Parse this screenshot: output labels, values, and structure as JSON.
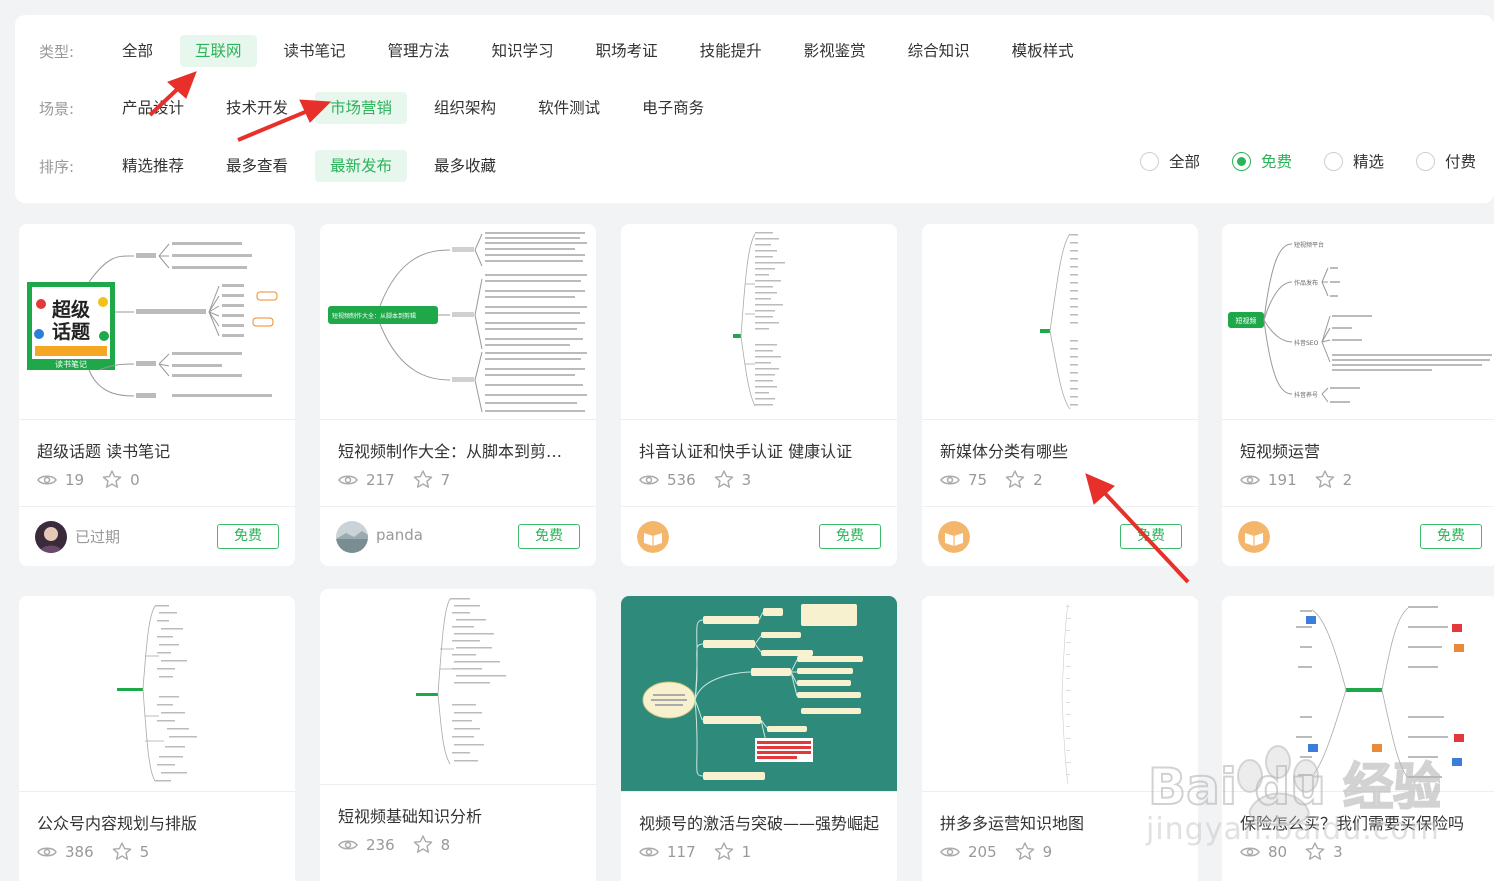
{
  "filters": {
    "type_label": "类型:",
    "types": [
      "全部",
      "互联网",
      "读书笔记",
      "管理方法",
      "知识学习",
      "职场考证",
      "技能提升",
      "影视鉴赏",
      "综合知识",
      "模板样式"
    ],
    "scene_label": "场景:",
    "scenes": [
      "产品设计",
      "技术开发",
      "市场营销",
      "组织架构",
      "软件测试",
      "电子商务"
    ],
    "sort_label": "排序:",
    "sorts": [
      "精选推荐",
      "最多查看",
      "最新发布",
      "最多收藏"
    ],
    "price_options": [
      "全部",
      "免费",
      "精选",
      "付费"
    ]
  },
  "colors": {
    "accent": "#2db35a",
    "accent_bg": "#e8f7ee",
    "arrow": "#e8302a",
    "teal_thumb": "#2e8a7a"
  },
  "cards": [
    {
      "title": "超级话题 读书笔记",
      "views": "19",
      "stars": "0",
      "user": "已过期",
      "badge": "免费"
    },
    {
      "title": "短视频制作大全：从脚本到剪辑的完整流程",
      "views": "217",
      "stars": "7",
      "user": "panda",
      "badge": "免费"
    },
    {
      "title": "抖音认证和快手认证 健康认证",
      "views": "536",
      "stars": "3",
      "user": "",
      "badge": "免费"
    },
    {
      "title": "新媒体分类有哪些",
      "views": "75",
      "stars": "2",
      "user": "",
      "badge": "免费"
    },
    {
      "title": "短视频运营",
      "views": "191",
      "stars": "2",
      "user": "",
      "badge": "免费"
    },
    {
      "title": "公众号内容规划与排版",
      "views": "386",
      "stars": "5"
    },
    {
      "title": "短视频基础知识分析",
      "views": "236",
      "stars": "8"
    },
    {
      "title": "视频号的激活与突破——强势崛起",
      "views": "117",
      "stars": "1"
    },
    {
      "title": "拼多多运营知识地图",
      "views": "205",
      "stars": "9"
    },
    {
      "title": "保险怎么买？我们需要买保险吗",
      "views": "80",
      "stars": "3"
    }
  ],
  "thumb_texts": {
    "book_line1": "超级",
    "book_line2": "话题",
    "book_small": "读书笔记",
    "map1_center": "短视频制作大全：从脚本到剪辑",
    "map5_center": "短视频",
    "map5_n1": "短视频平台",
    "map5_n2": "作品发布",
    "map5_n3": "抖音SEO",
    "map5_n4": "抖音养号"
  },
  "watermark": {
    "text": "jingyan.baidu.com",
    "logo": "Bai du 经验"
  }
}
